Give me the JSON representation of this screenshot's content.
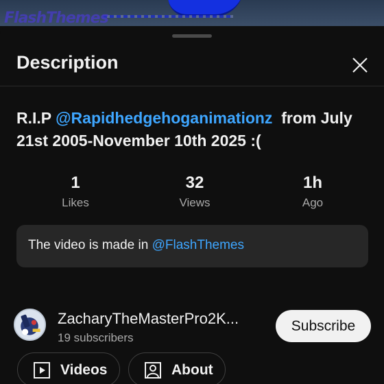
{
  "video_watermark": "FlashThemes",
  "sheet": {
    "title": "Description"
  },
  "description": {
    "prefix": "R.I.P",
    "mention": "@Rapidhedgehoganimationz",
    "suffix": "from July 21st 2005-November 10th 2025 :("
  },
  "stats": [
    {
      "value": "1",
      "label": "Likes"
    },
    {
      "value": "32",
      "label": "Views"
    },
    {
      "value": "1h",
      "label": "Ago"
    }
  ],
  "info": {
    "text": "The video is made in",
    "mention": "@FlashThemes"
  },
  "channel": {
    "name": "ZacharyTheMasterPro2K...",
    "subscribers": "19 subscribers",
    "subscribe_label": "Subscribe"
  },
  "buttons": {
    "videos": "Videos",
    "about": "About"
  },
  "colors": {
    "background": "#0f0f0f",
    "mention": "#3ea6ff",
    "card": "#272727"
  }
}
